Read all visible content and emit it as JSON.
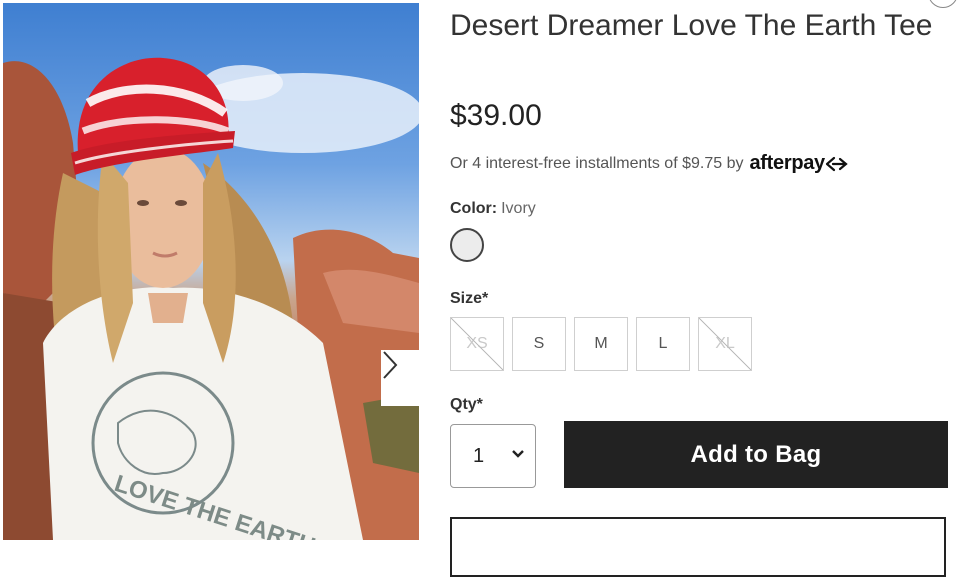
{
  "product": {
    "title": "Desert Dreamer Love The Earth Tee",
    "price": "$39.00",
    "installments_text": "Or 4 interest-free installments of $9.75 by",
    "afterpay_brand": "afterpay",
    "color_label": "Color:",
    "color_value": "Ivory",
    "swatch_color": "#ececec",
    "size_label": "Size*",
    "sizes": [
      {
        "label": "XS",
        "available": false
      },
      {
        "label": "S",
        "available": true
      },
      {
        "label": "M",
        "available": true
      },
      {
        "label": "L",
        "available": true
      },
      {
        "label": "XL",
        "available": false
      }
    ],
    "qty_label": "Qty*",
    "qty_value": "1",
    "add_to_bag": "Add to Bag"
  },
  "image": {
    "shirt_print": "LOVE THE EARTH",
    "next_icon": "chevron-right-icon"
  },
  "colors": {
    "primary_button": "#222222",
    "text": "#333333"
  }
}
